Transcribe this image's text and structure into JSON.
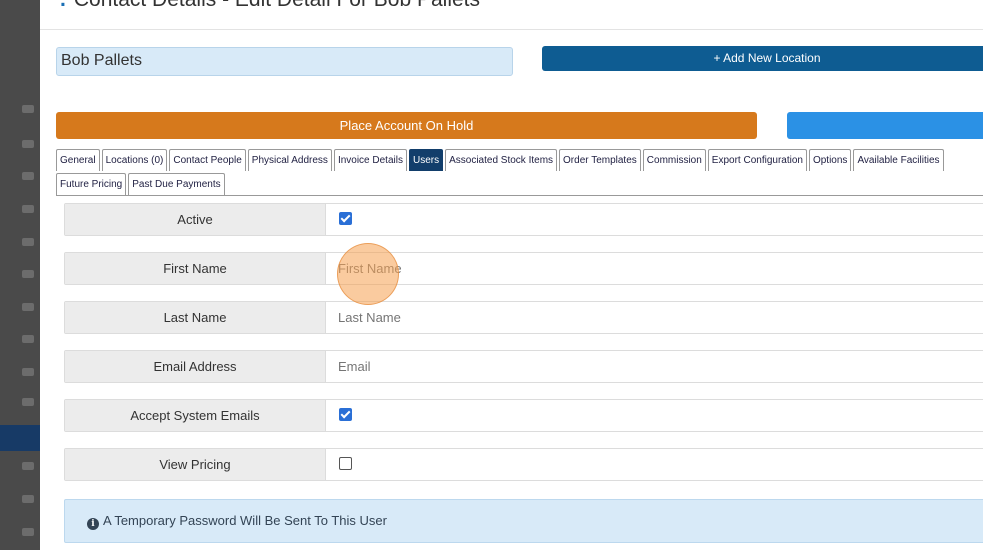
{
  "modal": {
    "title": "Contact Details - Edit Detail For Bob Pallets",
    "title_dot": "."
  },
  "account": {
    "name_value": "Bob Pallets"
  },
  "buttons": {
    "add_location": "+ Add New Location",
    "place_on_hold": "Place Account On Hold"
  },
  "tabs": {
    "row1": [
      "General",
      "Locations (0)",
      "Contact People",
      "Physical Address",
      "Invoice Details",
      "Users",
      "Associated Stock Items",
      "Order Templates",
      "Commission",
      "Export Configuration",
      "Options",
      "Available Facilities"
    ],
    "row2": [
      "Future Pricing",
      "Past Due Payments"
    ],
    "active": "Users"
  },
  "form": {
    "active_label": "Active",
    "active_checked": true,
    "first_name_label": "First Name",
    "first_name_placeholder": "First Name",
    "last_name_label": "Last Name",
    "last_name_placeholder": "Last Name",
    "email_label": "Email Address",
    "email_placeholder": "Email",
    "accept_emails_label": "Accept System Emails",
    "accept_emails_checked": true,
    "view_pricing_label": "View Pricing",
    "view_pricing_checked": false
  },
  "info": {
    "icon": "info-circle-icon",
    "text": "A Temporary Password Will Be Sent To This User"
  },
  "colors": {
    "primary_dark": "#0e5c92",
    "hold_orange": "#d6791c",
    "active_tab": "#123e6b",
    "info_bg": "#d8eaf8"
  }
}
